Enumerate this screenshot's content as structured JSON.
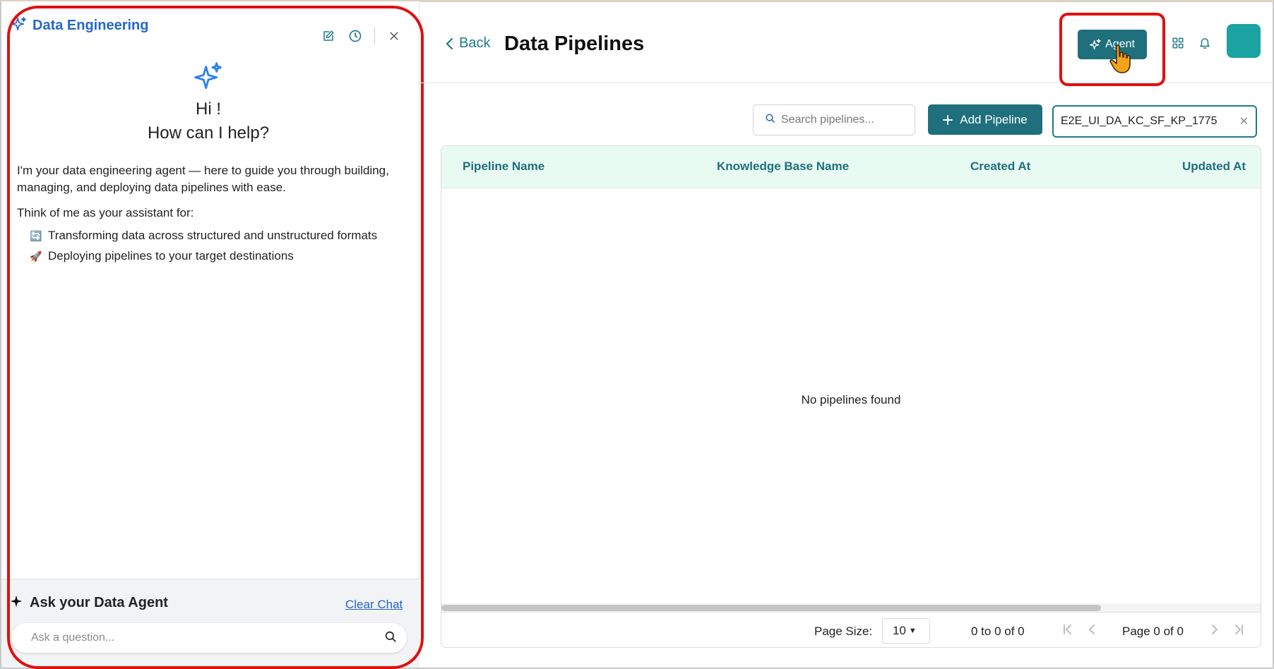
{
  "chat_panel": {
    "title": "Data Engineering",
    "greeting": "Hi !",
    "help_question": "How can I help?",
    "intro": "I'm your data engineering agent — here to guide you through building, managing, and deploying data pipelines with ease.",
    "think_label": "Think of me as your assistant for:",
    "features": [
      {
        "emoji": "🔄",
        "text": "Transforming data across structured and unstructured formats"
      },
      {
        "emoji": "🚀",
        "text": "Deploying pipelines to your target destinations"
      }
    ],
    "ask_title": "Ask your Data Agent",
    "clear_chat": "Clear Chat",
    "ask_placeholder": "Ask a question..."
  },
  "header": {
    "back_label": "Back",
    "page_title": "Data Pipelines",
    "agent_label": "Agent"
  },
  "toolbar": {
    "search_placeholder": "Search pipelines...",
    "add_label": "Add Pipeline",
    "filter_value": "E2E_UI_DA_KC_SF_KP_1775"
  },
  "table": {
    "columns": [
      "Pipeline Name",
      "Knowledge Base Name",
      "Created At",
      "Updated At"
    ],
    "empty_text": "No pipelines found",
    "page_size_label": "Page Size:",
    "page_size_value": "10",
    "range_text": "0 to 0 of 0",
    "page_text": "Page 0 of 0"
  },
  "colors": {
    "brand_teal": "#1f6f7d",
    "header_bg": "#e8fbf2",
    "link_blue": "#2567c9",
    "highlight_red": "#e01010",
    "avatar": "#1ba3a1"
  }
}
